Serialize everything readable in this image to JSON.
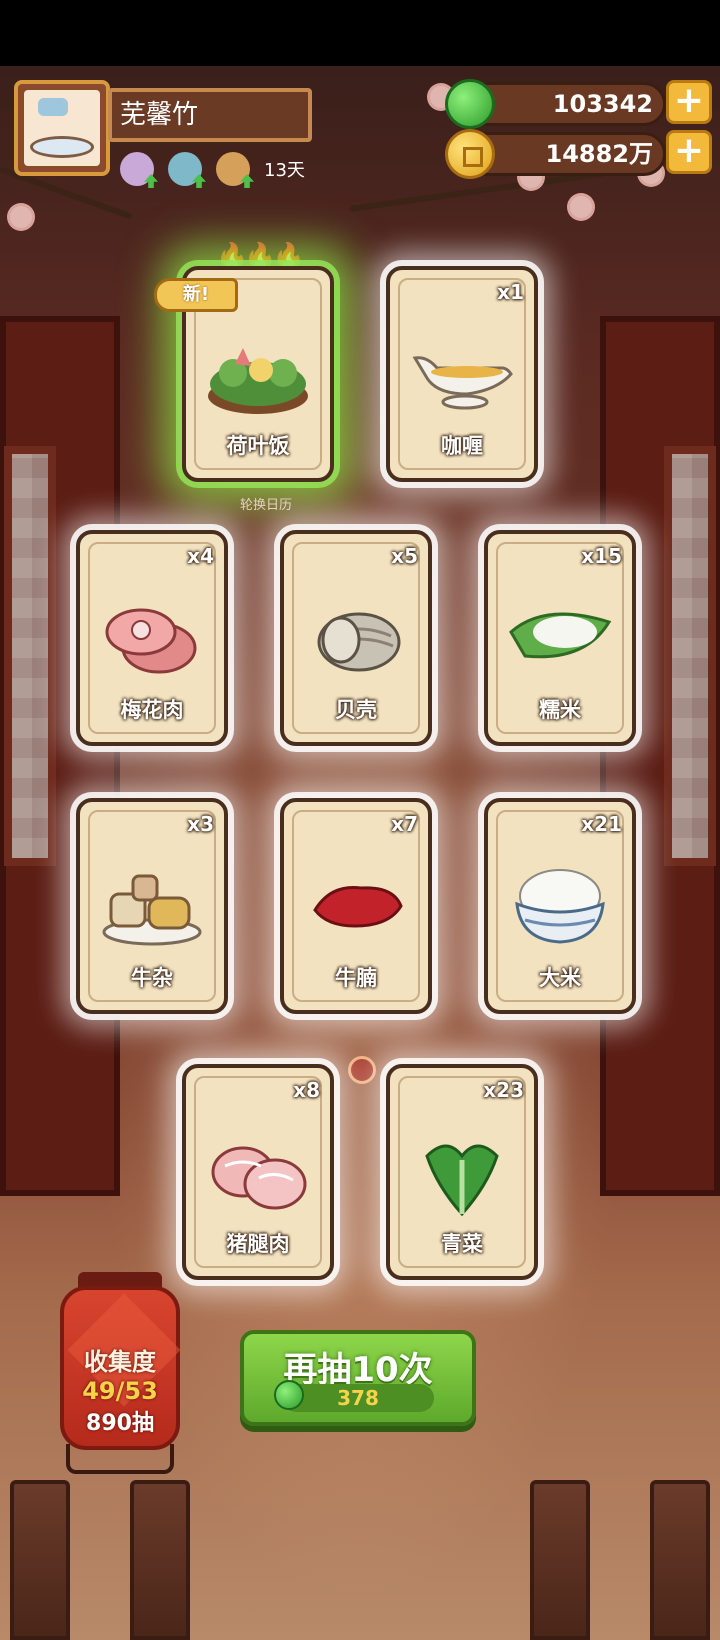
{
  "player": {
    "name": "芜馨竹",
    "days": "13天",
    "avatar_icon": "bath-tub-icon"
  },
  "currencies": [
    {
      "name": "jade",
      "value": "103342",
      "icon": "jade-coin-icon"
    },
    {
      "name": "coin",
      "value": "14882万",
      "icon": "gold-coin-icon"
    }
  ],
  "plus_label": "+",
  "cards": [
    {
      "id": "lotus-rice",
      "label": "荷叶饭",
      "count": "",
      "highlight": "green",
      "new": true
    },
    {
      "id": "curry",
      "label": "咖喱",
      "count": "x1"
    },
    {
      "id": "pork-shoulder",
      "label": "梅花肉",
      "count": "x4"
    },
    {
      "id": "shell",
      "label": "贝壳",
      "count": "x5"
    },
    {
      "id": "glutinous-rice",
      "label": "糯米",
      "count": "x15"
    },
    {
      "id": "beef-offal",
      "label": "牛杂",
      "count": "x3"
    },
    {
      "id": "beef-brisket",
      "label": "牛腩",
      "count": "x7"
    },
    {
      "id": "rice",
      "label": "大米",
      "count": "x21"
    },
    {
      "id": "pork-leg",
      "label": "猪腿肉",
      "count": "x8"
    },
    {
      "id": "greens",
      "label": "青菜",
      "count": "x23"
    }
  ],
  "new_badge": "新!",
  "caption": "轮换日历",
  "collection": {
    "title": "收集度",
    "progress": "49/53",
    "draws": "890抽"
  },
  "redraw": {
    "label": "再抽10次",
    "cost": "378"
  },
  "colors": {
    "jade": "#2b9b2a",
    "coin": "#e0a21b",
    "button_green": "#5ea92c",
    "lantern_red": "#b52a1c"
  }
}
